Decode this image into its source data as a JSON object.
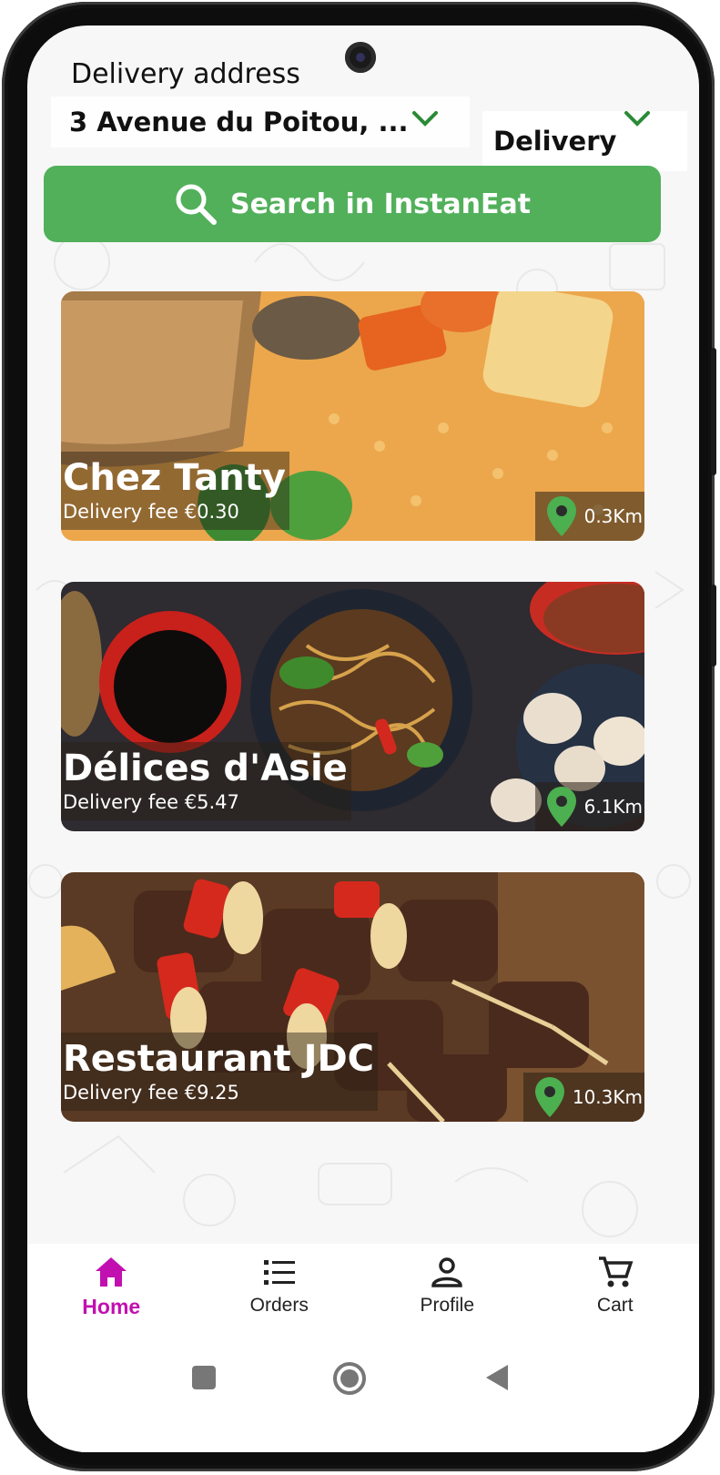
{
  "header": {
    "address_label": "Delivery address",
    "address_value": "3 Avenue du Poitou, ...",
    "mode_value": "Delivery"
  },
  "search": {
    "label": "Search in InstanEat"
  },
  "restaurants": [
    {
      "name": "Chez Tanty",
      "fee": "Delivery fee €0.30",
      "distance": "0.3Km"
    },
    {
      "name": "Délices d'Asie",
      "fee": "Delivery fee €5.47",
      "distance": "6.1Km"
    },
    {
      "name": "Restaurant JDC",
      "fee": "Delivery fee €9.25",
      "distance": "10.3Km"
    }
  ],
  "nav": {
    "home": "Home",
    "orders": "Orders",
    "profile": "Profile",
    "cart": "Cart"
  },
  "colors": {
    "accent_green": "#52b05b",
    "active_nav": "#c210b0",
    "pin_green": "#4caf50"
  },
  "icons": [
    "search-icon",
    "chevron-down-icon",
    "location-pin-icon",
    "home-icon",
    "list-icon",
    "person-icon",
    "cart-icon"
  ]
}
